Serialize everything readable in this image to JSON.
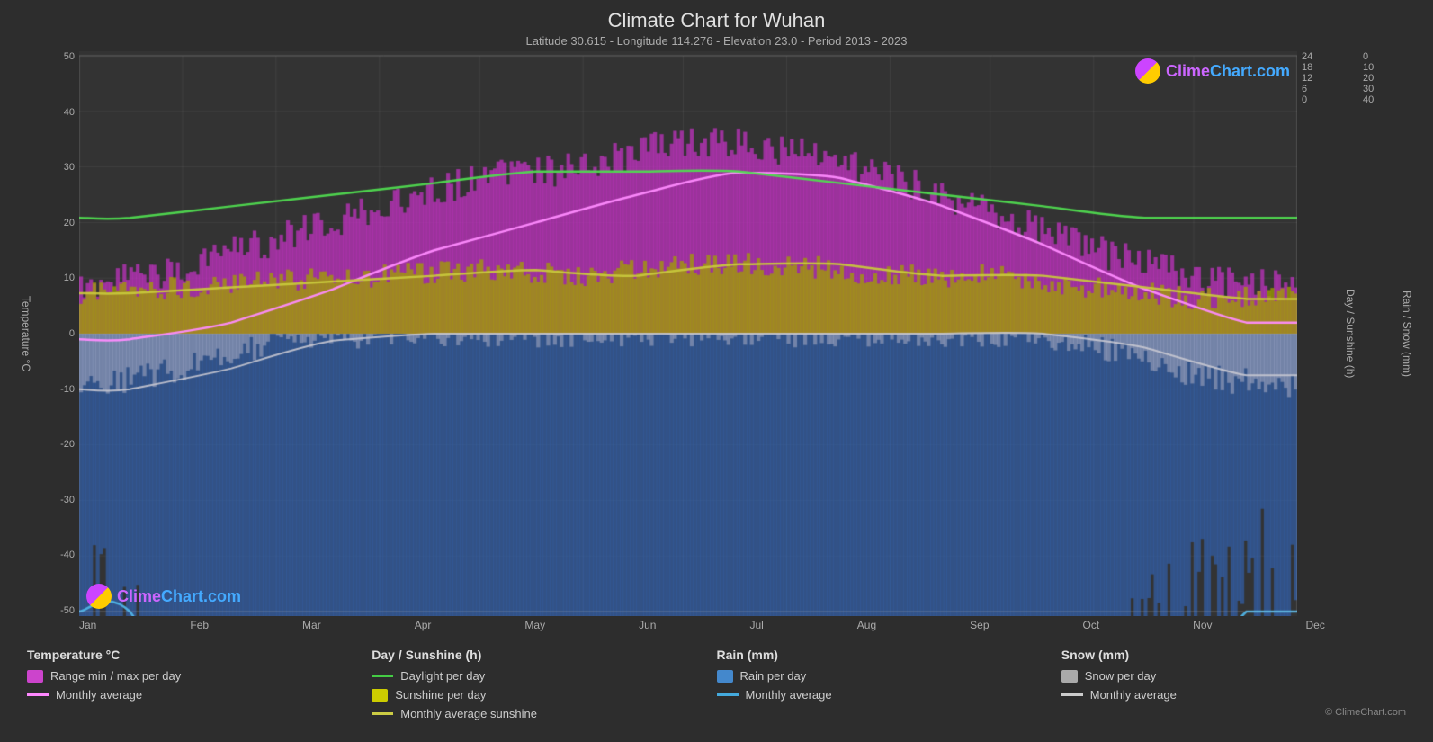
{
  "header": {
    "title": "Climate Chart for Wuhan",
    "subtitle": "Latitude 30.615 - Longitude 114.276 - Elevation 23.0 - Period 2013 - 2023"
  },
  "chart": {
    "y_left_label": "Temperature °C",
    "y_left_ticks": [
      "50",
      "40",
      "30",
      "20",
      "10",
      "0",
      "-10",
      "-20",
      "-30",
      "-40",
      "-50"
    ],
    "y_right_label1": "Day / Sunshine (h)",
    "y_right_ticks1": [
      "24",
      "18",
      "12",
      "6",
      "0"
    ],
    "y_right_label2": "Rain / Snow (mm)",
    "y_right_ticks2": [
      "0",
      "10",
      "20",
      "30",
      "40"
    ],
    "x_labels": [
      "Jan",
      "Feb",
      "Mar",
      "Apr",
      "May",
      "Jun",
      "Jul",
      "Aug",
      "Sep",
      "Oct",
      "Nov",
      "Dec"
    ]
  },
  "legend": {
    "col1_title": "Temperature °C",
    "col1_items": [
      {
        "type": "swatch",
        "color": "#cc44cc",
        "label": "Range min / max per day"
      },
      {
        "type": "line",
        "color": "#ff88ff",
        "label": "Monthly average"
      }
    ],
    "col2_title": "Day / Sunshine (h)",
    "col2_items": [
      {
        "type": "line",
        "color": "#44cc44",
        "label": "Daylight per day"
      },
      {
        "type": "swatch",
        "color": "#cccc00",
        "label": "Sunshine per day"
      },
      {
        "type": "line",
        "color": "#cccc44",
        "label": "Monthly average sunshine"
      }
    ],
    "col3_title": "Rain (mm)",
    "col3_items": [
      {
        "type": "swatch",
        "color": "#4488cc",
        "label": "Rain per day"
      },
      {
        "type": "line",
        "color": "#44aadd",
        "label": "Monthly average"
      }
    ],
    "col4_title": "Snow (mm)",
    "col4_items": [
      {
        "type": "swatch",
        "color": "#aaaaaa",
        "label": "Snow per day"
      },
      {
        "type": "line",
        "color": "#cccccc",
        "label": "Monthly average"
      }
    ]
  },
  "watermark": {
    "text": "ClimeChart.com",
    "copyright": "© ClimeChart.com"
  }
}
